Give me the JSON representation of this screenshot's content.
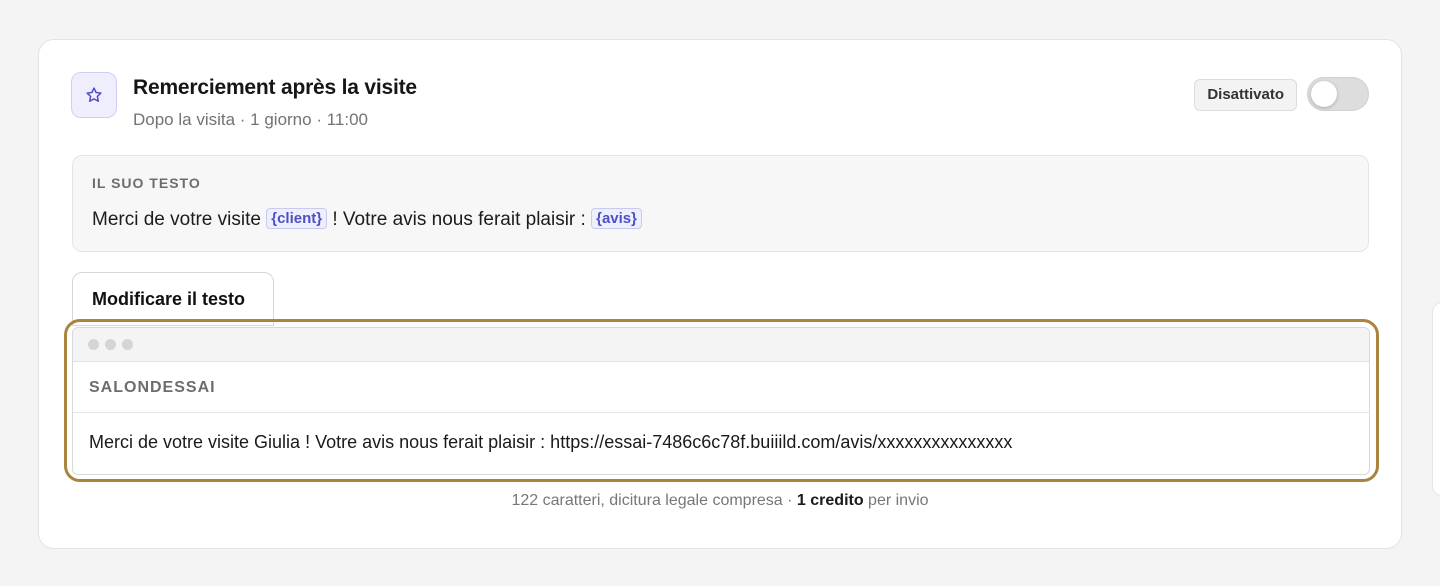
{
  "card": {
    "title": "Remerciement après la visite",
    "subtitle": "Dopo la visita · 1 giorno · 11:00",
    "status_badge": "Disattivato",
    "toggle_on": false,
    "icon": "star-icon"
  },
  "text_box": {
    "label": "IL SUO TESTO",
    "part1": "Merci de votre visite ",
    "var1": "{client}",
    "part2": " ! Votre avis nous ferait plaisir : ",
    "var2": "{avis}"
  },
  "edit_button": {
    "label": "Modificare il testo"
  },
  "preview": {
    "sender": "SALONDESSAI",
    "message": "Merci de votre visite Giulia ! Votre avis nous ferait plaisir : https://essai-7486c6c78f.buiiild.com/avis/xxxxxxxxxxxxxxx"
  },
  "footer": {
    "part1": "122 caratteri, dicitura legale compresa · ",
    "credit": "1 credito",
    "part2": " per invio"
  },
  "colors": {
    "accent": "#4f4fc4",
    "highlight_frame": "#a8843f"
  }
}
